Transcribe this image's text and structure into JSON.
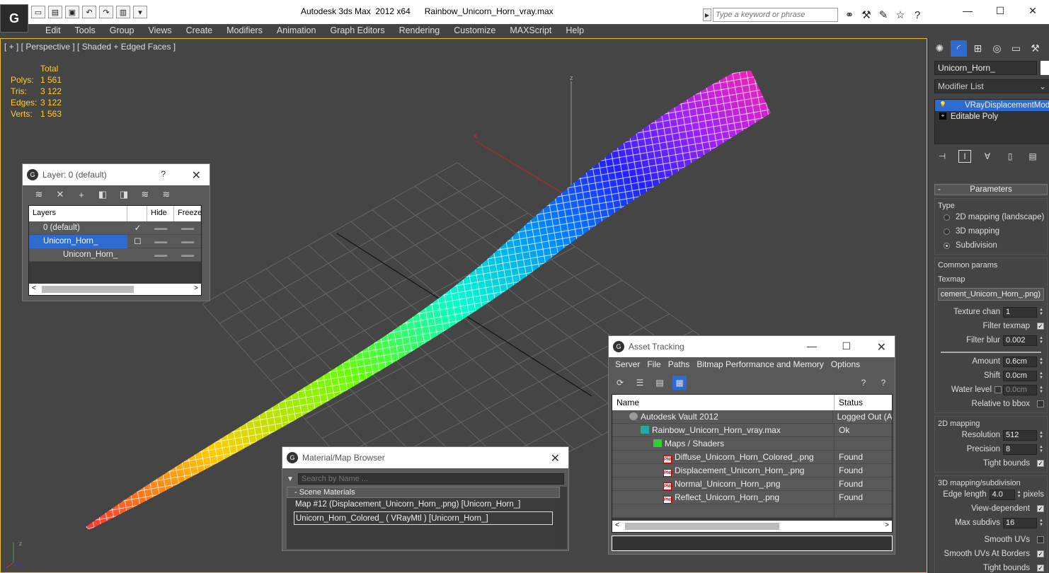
{
  "app": {
    "logo": "G",
    "title": "Autodesk 3ds Max  2012 x64      Rainbow_Unicorn_Horn_vray.max",
    "search_placeholder": "Type a keyword or phrase",
    "quick_access": [
      "new-icon",
      "open-icon",
      "save-icon",
      "undo-icon",
      "redo-icon",
      "project-icon"
    ],
    "toolbar_icons": [
      "binoculars-icon",
      "tools-icon",
      "communication-icon",
      "star-icon",
      "help-icon"
    ],
    "window_controls": {
      "minimize": "—",
      "maximize": "☐",
      "close": "✕"
    }
  },
  "menu": [
    "Edit",
    "Tools",
    "Group",
    "Views",
    "Create",
    "Modifiers",
    "Animation",
    "Graph Editors",
    "Rendering",
    "Customize",
    "MAXScript",
    "Help"
  ],
  "viewport": {
    "label": "[ + ] [ Perspective ] [ Shaded + Edged Faces ]",
    "stats": {
      "header": "Total",
      "rows": [
        {
          "key": "Polys:",
          "value": "1 561"
        },
        {
          "key": "Tris:",
          "value": "3 122"
        },
        {
          "key": "Edges:",
          "value": "3 122"
        },
        {
          "key": "Verts:",
          "value": "1 563"
        }
      ]
    },
    "axis_labels": {
      "x": "x",
      "y": "y",
      "z": "z"
    }
  },
  "layer_panel": {
    "title": "Layer: 0 (default)",
    "help": "?",
    "close": "✕",
    "columns": [
      "Layers",
      "",
      "Hide",
      "Freeze"
    ],
    "rows": [
      {
        "name": "0 (default)",
        "check": "✓",
        "hide": "▬▬",
        "freeze": "▬▬"
      },
      {
        "name": "Unicorn_Horn_",
        "check": "☐",
        "hide": "▬▬",
        "freeze": "▬▬"
      },
      {
        "name": "Unicorn_Horn_",
        "check": "",
        "hide": "▬▬",
        "freeze": "▬▬"
      }
    ]
  },
  "material_browser": {
    "title": "Material/Map Browser",
    "close": "✕",
    "search_placeholder": "Search by Name ...",
    "section": "- Scene Materials",
    "items": [
      "Map #12 (Displacement_Unicorn_Horn_.png)  [Unicorn_Horn_]",
      "Unicorn_Horn_Colored_  ( VRayMtl )  [Unicorn_Horn_]"
    ]
  },
  "asset_tracking": {
    "title": "Asset Tracking",
    "controls": {
      "minimize": "—",
      "maximize": "☐",
      "close": "✕"
    },
    "menu": [
      "Server",
      "File",
      "Paths",
      "Bitmap Performance and Memory",
      "Options"
    ],
    "columns": {
      "name": "Name",
      "status": "Status"
    },
    "rows": [
      {
        "name": "Autodesk Vault 2012",
        "status": "Logged Out (A",
        "indent": 24,
        "icon": "vault"
      },
      {
        "name": "Rainbow_Unicorn_Horn_vray.max",
        "status": "Ok",
        "indent": 40,
        "icon": "max"
      },
      {
        "name": "Maps / Shaders",
        "status": "",
        "indent": 58,
        "icon": "maps"
      },
      {
        "name": "Diffuse_Unicorn_Horn_Colored_.png",
        "status": "Found",
        "indent": 72,
        "icon": "png"
      },
      {
        "name": "Displacement_Unicorn_Horn_.png",
        "status": "Found",
        "indent": 72,
        "icon": "png"
      },
      {
        "name": "Normal_Unicorn_Horn_.png",
        "status": "Found",
        "indent": 72,
        "icon": "png"
      },
      {
        "name": "Reflect_Unicorn_Horn_.png",
        "status": "Found",
        "indent": 72,
        "icon": "png"
      }
    ]
  },
  "command_panel": {
    "object_name": "Unicorn_Horn_",
    "modifier_list": "Modifier List",
    "stack": [
      "VRayDisplacementMod",
      "Editable Poly"
    ],
    "rollout": "Parameters",
    "type_label": "Type",
    "type_options": [
      {
        "label": "2D mapping (landscape)",
        "on": false
      },
      {
        "label": "3D mapping",
        "on": false
      },
      {
        "label": "Subdivision",
        "on": true
      }
    ],
    "common_label": "Common params",
    "texmap_label": "Texmap",
    "texmap_value": "cement_Unicorn_Horn_.png)",
    "texture_chan_label": "Texture chan",
    "texture_chan": "1",
    "filter_texmap_label": "Filter texmap",
    "filter_blur_label": "Filter blur",
    "filter_blur": "0.002",
    "amount_label": "Amount",
    "amount": "0.6cm",
    "shift_label": "Shift",
    "shift": "0.0cm",
    "water_level_label": "Water level",
    "water_level": "0.0cm",
    "relative_bbox_label": "Relative to bbox",
    "mapping2d_label": "2D mapping",
    "resolution_label": "Resolution",
    "resolution": "512",
    "precision_label": "Precision",
    "precision": "8",
    "tight_bounds_label": "Tight bounds",
    "mapping3d_label": "3D mapping/subdivision",
    "edge_length_label": "Edge length",
    "edge_length": "4.0",
    "pixels_label": "pixels",
    "view_dependent_label": "View-dependent",
    "max_subdivs_label": "Max subdivs",
    "max_subdivs": "16",
    "smooth_uvs_label": "Smooth UVs",
    "smooth_uvs_borders_label": "Smooth UVs At Borders",
    "tight_bounds2_label": "Tight bounds"
  }
}
